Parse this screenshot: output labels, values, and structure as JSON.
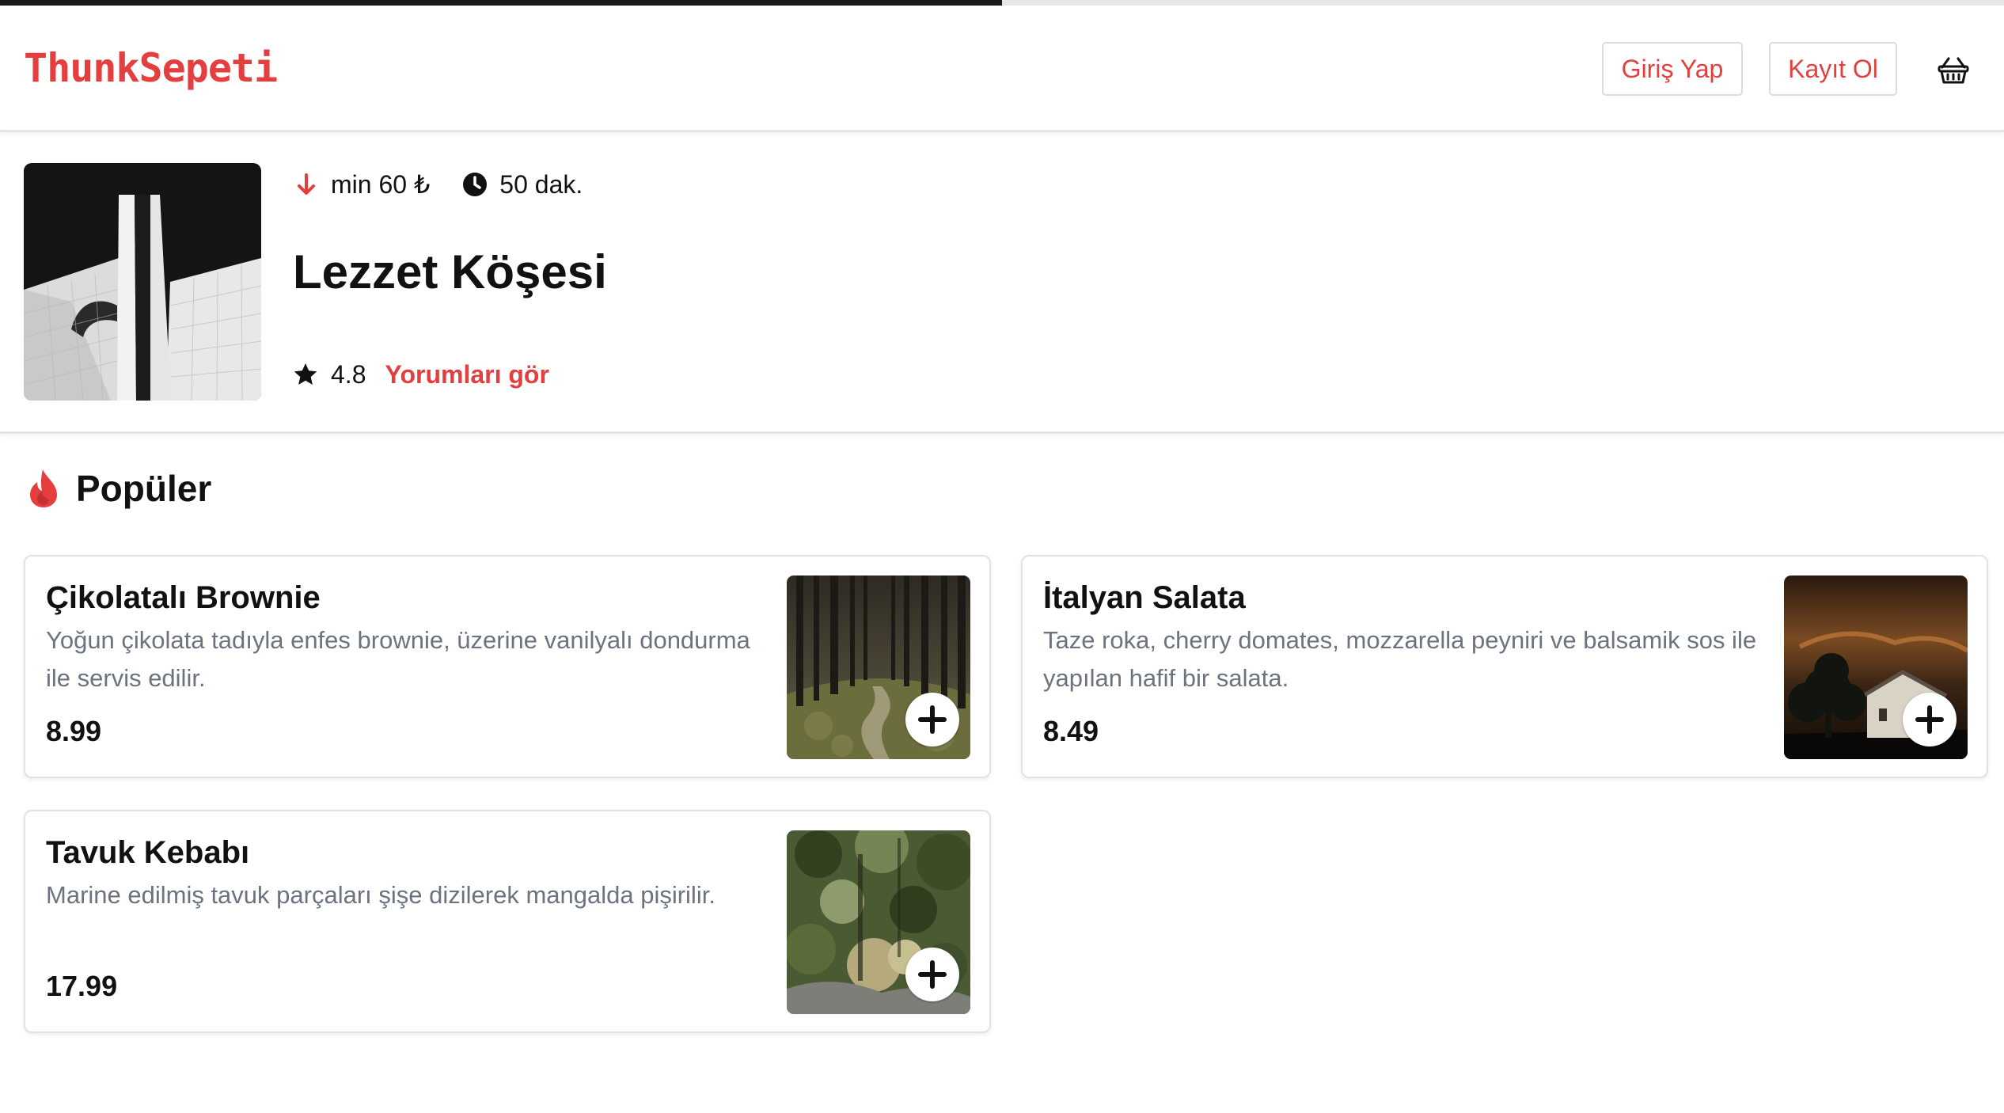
{
  "header": {
    "logo": "ThunkSepeti",
    "login_label": "Giriş Yap",
    "signup_label": "Kayıt Ol",
    "basket_icon": "basket-icon",
    "loading_progress": 0.5
  },
  "restaurant": {
    "min_order": "min 60 ₺",
    "delivery_time": "50 dak.",
    "name": "Lezzet Köşesi",
    "rating": "4.8",
    "reviews_link": "Yorumları gör"
  },
  "popular": {
    "title": "Popüler",
    "icon": "fire-icon",
    "items": [
      {
        "name": "Çikolatalı Brownie",
        "description": "Yoğun çikolata tadıyla enfes brownie, üzerine vanilyalı dondurma ile servis edilir.",
        "price": "8.99"
      },
      {
        "name": "İtalyan Salata",
        "description": "Taze roka, cherry domates, mozzarella peyniri ve balsamik sos ile yapılan hafif bir salata.",
        "price": "8.49"
      },
      {
        "name": "Tavuk Kebabı",
        "description": "Marine edilmiş tavuk parçaları şişe dizilerek mangalda pişirilir.",
        "price": "17.99"
      }
    ]
  },
  "colors": {
    "accent": "#e53e3e",
    "muted_text": "#6b7280",
    "border": "#e2e2e2"
  }
}
